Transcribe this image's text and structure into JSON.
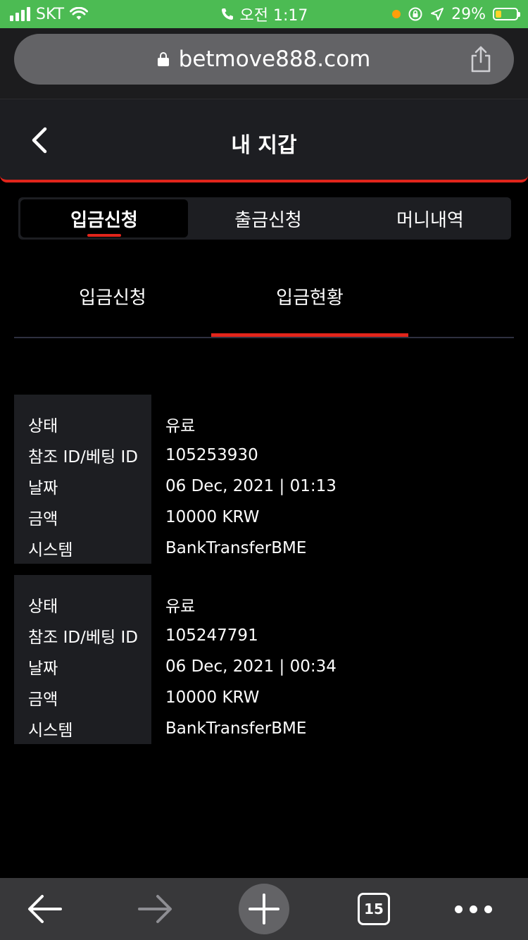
{
  "status_bar": {
    "carrier": "SKT",
    "time": "오전 1:17",
    "battery_percent": "29%",
    "battery_level": 0.29,
    "signal_bars": 4,
    "icons": [
      "signal-icon",
      "wifi-icon",
      "phone-icon",
      "orange-dot-icon",
      "screen-rotation-lock-icon",
      "location-arrow-icon",
      "battery-icon"
    ]
  },
  "browser": {
    "url": "betmove888.com",
    "icons": [
      "lock-icon",
      "share-icon"
    ]
  },
  "header": {
    "title": "내 지갑",
    "back_icon": "chevron-left-icon"
  },
  "main_tabs": [
    {
      "label": "입금신청",
      "active": true
    },
    {
      "label": "출금신청",
      "active": false
    },
    {
      "label": "머니내역",
      "active": false
    }
  ],
  "sub_tabs": [
    {
      "label": "입금신청",
      "active": false
    },
    {
      "label": "입금현황",
      "active": true
    }
  ],
  "record_labels": {
    "status": "상태",
    "ref_id": "참조 ID/베팅 ID",
    "date": "날짜",
    "amount": "금액",
    "system": "시스템"
  },
  "records": [
    {
      "status": "유료",
      "ref_id": "105253930",
      "date": "06 Dec, 2021 | 01:13",
      "amount": "10000 KRW",
      "system": "BankTransferBME"
    },
    {
      "status": "유료",
      "ref_id": "105247791",
      "date": "06 Dec, 2021 | 00:34",
      "amount": "10000 KRW",
      "system": "BankTransferBME"
    }
  ],
  "toolbar": {
    "tabs_count": "15",
    "icons": [
      "back-arrow-icon",
      "forward-arrow-icon",
      "new-tab-plus-icon",
      "tabs-icon",
      "more-dots-icon"
    ]
  },
  "colors": {
    "accent": "#e1251b",
    "status_bar": "#4cbb53",
    "panel": "#1d1e22"
  }
}
